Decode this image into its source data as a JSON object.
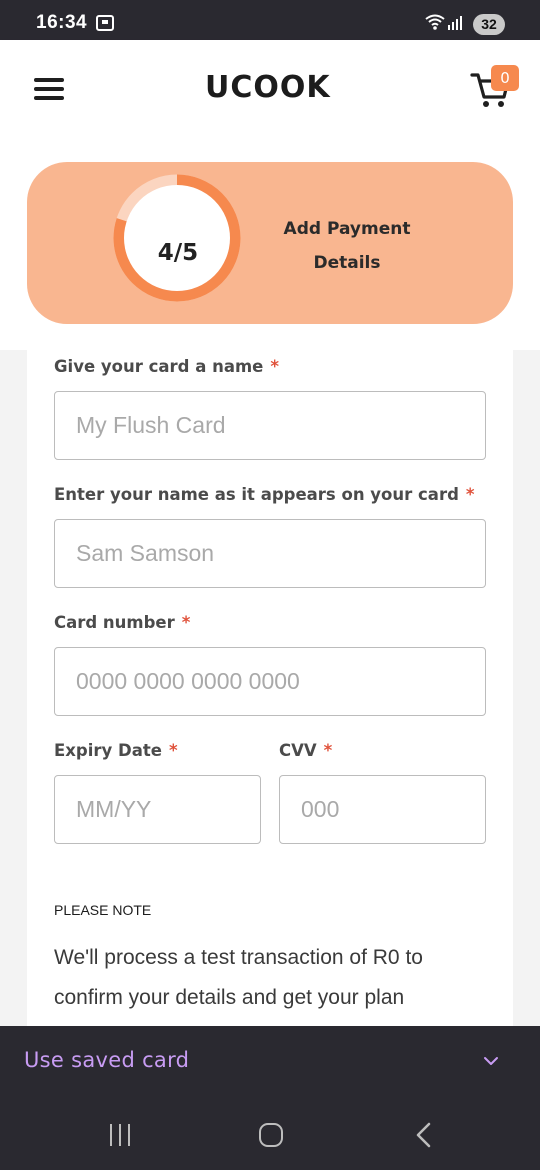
{
  "status_bar": {
    "time": "16:34",
    "battery": "32",
    "icons": [
      "screen-record-icon",
      "wifi-icon",
      "signal-icon"
    ]
  },
  "header": {
    "logo": "UCOOK",
    "cart_count": "0",
    "icons": [
      "hamburger-menu-icon",
      "shopping-cart-icon"
    ]
  },
  "progress": {
    "step": "4/5",
    "title": "Add Payment Details",
    "completed_fraction": 0.8,
    "colors": {
      "card": "#f9b690",
      "ring": "#f6894e",
      "ring_track": "#fbd5c0"
    }
  },
  "form": {
    "card_name": {
      "label": "Give your card a name",
      "required_mark": "*",
      "placeholder": "My Flush Card"
    },
    "holder_name": {
      "label": "Enter your name as it appears on your card",
      "required_mark": "*",
      "placeholder": "Sam Samson"
    },
    "card_number": {
      "label": "Card number",
      "required_mark": "*",
      "placeholder": "0000 0000 0000 0000"
    },
    "expiry": {
      "label": "Expiry Date",
      "required_mark": "*",
      "placeholder": "MM/YY"
    },
    "cvv": {
      "label": "CVV",
      "required_mark": "*",
      "placeholder": "000"
    }
  },
  "note": {
    "title": "PLEASE NOTE",
    "text": "We'll process a test transaction of R0 to confirm your details and get your plan"
  },
  "saved_card": {
    "label": "Use saved card",
    "color": "#c89cf3"
  },
  "nav_bar": {
    "icons": [
      "recents-icon",
      "home-icon",
      "back-icon"
    ]
  }
}
